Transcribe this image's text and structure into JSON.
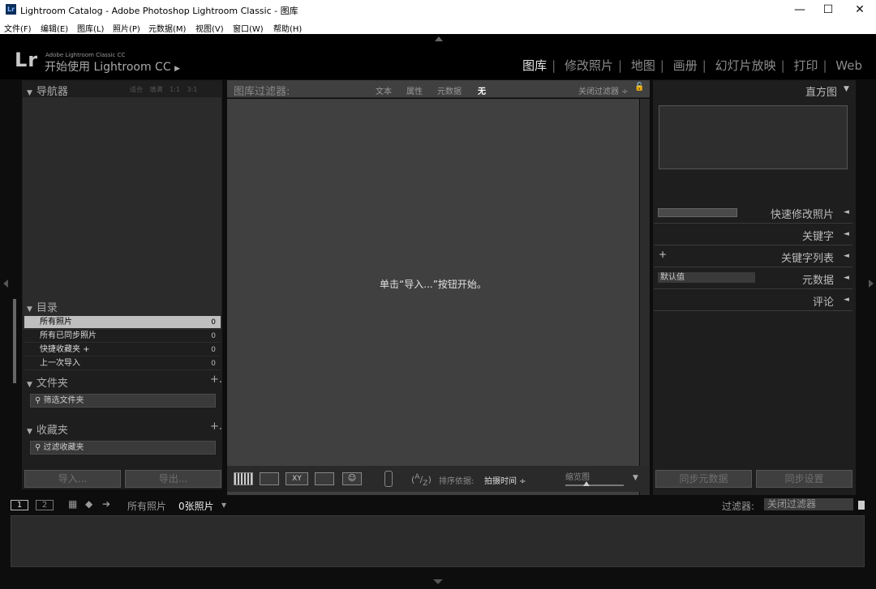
{
  "window": {
    "title": "Lightroom Catalog - Adobe Photoshop Lightroom Classic - 图库",
    "app_icon": "Lr",
    "minimize": "—",
    "maximize": "☐",
    "close": "✕"
  },
  "menu": [
    "文件(F)",
    "编辑(E)",
    "图库(L)",
    "照片(P)",
    "元数据(M)",
    "视图(V)",
    "窗口(W)",
    "帮助(H)"
  ],
  "identity": {
    "logo": "Lr",
    "small": "Adobe Lightroom Classic CC",
    "big": "开始使用 Lightroom CC",
    "arrow": "▶"
  },
  "modules": [
    "图库",
    "修改照片",
    "地图",
    "画册",
    "幻灯片放映",
    "打印",
    "Web"
  ],
  "modules_sep": "|",
  "left": {
    "navigator": {
      "title": "导航器",
      "options": "适合 填满 1:1 3:1"
    },
    "catalog": {
      "title": "目录",
      "items": [
        {
          "label": "所有照片",
          "count": "0"
        },
        {
          "label": "所有已同步照片",
          "count": "0"
        },
        {
          "label": "快捷收藏夹 +",
          "count": "0"
        },
        {
          "label": "上一次导入",
          "count": "0"
        }
      ]
    },
    "folders": {
      "title": "文件夹",
      "plus": "+.",
      "filter_placeholder": "筛选文件夹"
    },
    "collections": {
      "title": "收藏夹",
      "plus": "+.",
      "filter_placeholder": "过滤收藏夹"
    },
    "import_btn": "导入...",
    "export_btn": "导出...",
    "arrow": "▼"
  },
  "filterbar": {
    "label": "图库过滤器:",
    "tabs": [
      "文本",
      "属性",
      "元数据",
      "无"
    ],
    "close_filter": "关闭过滤器 ÷",
    "lock_icon": "🔓"
  },
  "center_message": "单击“导入...”按钮开始。",
  "toolbar": {
    "sort_label": "排序依据:",
    "sort_value": "拍摄时间 ÷",
    "thumb_label": "缩览图",
    "menu_arrow": "▼"
  },
  "right": {
    "histogram": "直方图",
    "quick_develop": "快速修改照片",
    "keywording": "关键字",
    "keyword_list": "关键字列表",
    "metadata": "元数据",
    "metadata_preset": "默认值",
    "comments": "评论",
    "plus": "+",
    "collapse_arrow": "◄",
    "down_arrow": "▼",
    "sync_metadata": "同步元数据",
    "sync_settings": "同步设置"
  },
  "filmstrip": {
    "screen1": "1",
    "screen2": "2",
    "source": "所有照片",
    "count": "0张照片",
    "dropdown": "▾",
    "filter_label": "过滤器:",
    "filter_value": "关闭过滤器"
  },
  "colors": {
    "panel": "#1e1e1e",
    "grid": "#404040",
    "active_module": "#e6e6e6",
    "selected_row": "#bfbfbf"
  }
}
